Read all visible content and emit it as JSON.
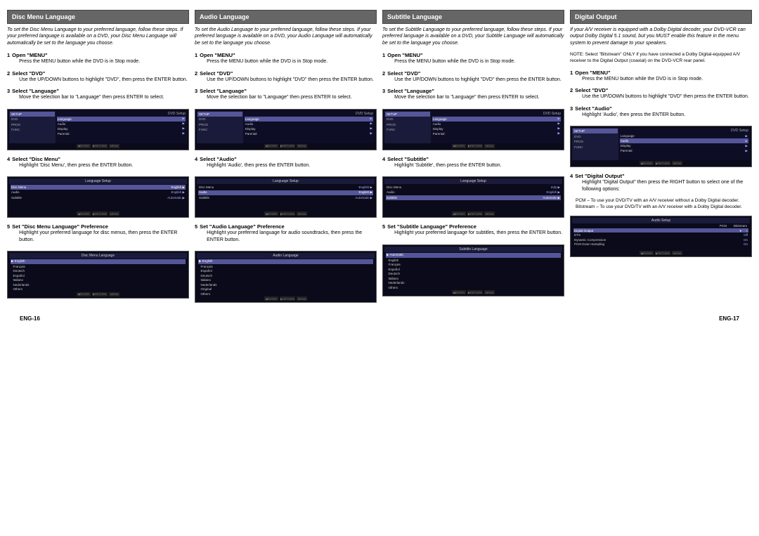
{
  "headers": [
    "Disc Menu Language",
    "Audio Language",
    "Subtitle Language",
    "Digital Output"
  ],
  "col1": {
    "intro": "To set the Disc Menu Language to your preferred language, follow these steps. If your preferred language is available on a DVD, your Disc Menu Language will automatically be set to the language you choose.",
    "steps": [
      {
        "num": "1",
        "title": "Open \"MENU\"",
        "body": "Press the MENU button while the DVD is in Stop mode."
      },
      {
        "num": "2",
        "title": "Select \"DVD\"",
        "body": "Use the UP/DOWN buttons to highlight \"DVD\", then press the ENTER button."
      },
      {
        "num": "3",
        "title": "Select \"Language\"",
        "body": "Move the selection bar to \"Language\" then press ENTER to select."
      },
      {
        "num": "4",
        "title": "Select \"Disc Menu\"",
        "body": "Highlight 'Disc Menu', then press the ENTER button."
      },
      {
        "num": "5",
        "title": "Set \"Disc Menu Language\" Preference",
        "body": "Highlight your preferred language for disc menus, then press the ENTER button."
      }
    ],
    "screen1_header": "DVD Setup",
    "screen1_left": [
      "SETUP",
      "DVD",
      "PROG",
      "FUNC"
    ],
    "screen1_right": [
      "Language",
      "Audio",
      "Display",
      "Parental"
    ],
    "screen2_header": "Language Setup",
    "screen2_rows": [
      {
        "label": "Disc Menu",
        "value": "English"
      },
      {
        "label": "Audio",
        "value": "English"
      },
      {
        "label": "Subtitle",
        "value": "Automatic"
      }
    ],
    "screen3_header": "Disc Menu Language",
    "screen3_items": [
      "English",
      "Français",
      "Deutsch",
      "Español",
      "Italiano",
      "Nederlands",
      "Others"
    ],
    "screen3_selected": "English"
  },
  "col2": {
    "intro": "To set the Audio Language to your preferred language, follow these steps. If your preferred language is available on a DVD, your Audio Language will automatically be set to the language you choose.",
    "steps": [
      {
        "num": "1",
        "title": "Open \"MENU\"",
        "body": "Press the MENU button while the DVD is in Stop mode."
      },
      {
        "num": "2",
        "title": "Select \"DVD\"",
        "body": "Use the UP/DOWN buttons to highlight \"DVD\" then press the ENTER button."
      },
      {
        "num": "3",
        "title": "Select \"Language\"",
        "body": "Move the selection bar to \"Language\" then press ENTER to select."
      },
      {
        "num": "4",
        "title": "Select \"Audio\"",
        "body": "Highlight 'Audio', then press the ENTER button."
      },
      {
        "num": "5",
        "title": "Set \"Audio Language\" Preference",
        "body": "Highlight your preferred language for audio soundtracks, then press the ENTER button."
      }
    ],
    "screen1_header": "DVD Setup",
    "screen1_left": [
      "SETUP",
      "DVD",
      "PROG",
      "FUNC"
    ],
    "screen1_right": [
      "Language",
      "Audio",
      "Display",
      "Parental"
    ],
    "screen2_header": "Language Setup",
    "screen2_rows": [
      {
        "label": "Disc Menu",
        "value": "English"
      },
      {
        "label": "Audio",
        "value": "English"
      },
      {
        "label": "Subtitle",
        "value": "Automatic"
      }
    ],
    "screen3_header": "Audio Language",
    "screen3_items": [
      "English",
      "Français",
      "Español",
      "Deutsch",
      "Italiano",
      "Nederlands",
      "Original",
      "Others"
    ],
    "screen3_selected": "English"
  },
  "col3": {
    "intro": "To set the Subtitle Language to your preferred language, follow these steps. If your preferred language is available on a DVD, your Subtitle Language will automatically be set to the language you choose.",
    "steps": [
      {
        "num": "1",
        "title": "Open \"MENU\"",
        "body": "Press the MENU button while the DVD is in Stop mode."
      },
      {
        "num": "2",
        "title": "Select \"DVD\"",
        "body": "Use the UP/DOWN buttons to highlight \"DVD\" then press the ENTER button."
      },
      {
        "num": "3",
        "title": "Select \"Language\"",
        "body": "Move the selection bar to \"Language\" then press ENTER to select."
      },
      {
        "num": "4",
        "title": "Select \"Subtitle\"",
        "body": "Highlight 'Subtitle', then press the ENTER button."
      },
      {
        "num": "5",
        "title": "Set \"Subtitle Language\" Preference",
        "body": "Highlight your preferred language for subtitles, then press the ENTER button."
      }
    ],
    "screen1_header": "DVD Setup",
    "screen1_left": [
      "SETUP",
      "DVD",
      "PROG",
      "FUNC"
    ],
    "screen1_right": [
      "Language",
      "Audio",
      "Display",
      "Parental"
    ],
    "screen2_header": "Language Setup",
    "screen2_rows": [
      {
        "label": "Disc Menu",
        "value": "Indy"
      },
      {
        "label": "Audio",
        "value": "English"
      },
      {
        "label": "Subtitle",
        "value": "Automatic"
      }
    ],
    "screen3_header": "Subtitle Language",
    "screen3_items": [
      "Automatic",
      "English",
      "Français",
      "Español",
      "Deutsch",
      "Italiano",
      "Nederlands",
      "Others"
    ],
    "screen3_selected": "Automatic"
  },
  "col4": {
    "intro": "If your A/V receiver is equipped with a Dolby Digital decoder, your DVD-VCR can output Dolby Digital 5.1 sound, but you MUST enable this feature in the menu system to prevent damage to your speakers.",
    "note": "NOTE: Select \"Bitstream\" ONLY if you have connected a Dolby Digital-equipped A/V receiver to the Digital Output (coaxial) on the DVD-VCR rear panel.",
    "steps": [
      {
        "num": "1",
        "title": "Open \"MENU\"",
        "body": "Press the MENU button while the DVD is in Stop mode."
      },
      {
        "num": "2",
        "title": "Select \"DVD\"",
        "body": "Use the UP/DOWN buttons to highlight \"DVD\" then press the ENTER button."
      },
      {
        "num": "3",
        "title": "Select \"Audio\"",
        "body": "Highlight 'Audio', then press the ENTER button."
      },
      {
        "num": "4",
        "title": "Set \"Digital Output\"",
        "body": "Highlight \"Digital Output\" then press the RIGHT button to select one of the following options:"
      }
    ],
    "bullets": [
      "PCM –   To use your DVD/TV with an A/V receiver without a Dolby Digital decoder.",
      "Bitstream – To use your DVD/TV with an A/V receiver with a Dolby Digital decoder."
    ],
    "screen1_header": "DVD Setup",
    "screen1_left": [
      "SETUP",
      "DVD",
      "PROG",
      "FUNC"
    ],
    "screen1_right": [
      "Language",
      "Audio",
      "Display",
      "Parental"
    ],
    "screen2_header": "Audio Setup",
    "screen2_rows": [
      {
        "label": "Digital Output",
        "value": "PCM",
        "value2": "Bitstream"
      },
      {
        "label": "DTS",
        "value": "Off"
      },
      {
        "label": "Dynamic Compression",
        "value": "On"
      },
      {
        "label": "PCM Down-Sampling",
        "value": "On"
      }
    ]
  },
  "footer": {
    "left": "ENG-16",
    "right": "ENG-17"
  }
}
